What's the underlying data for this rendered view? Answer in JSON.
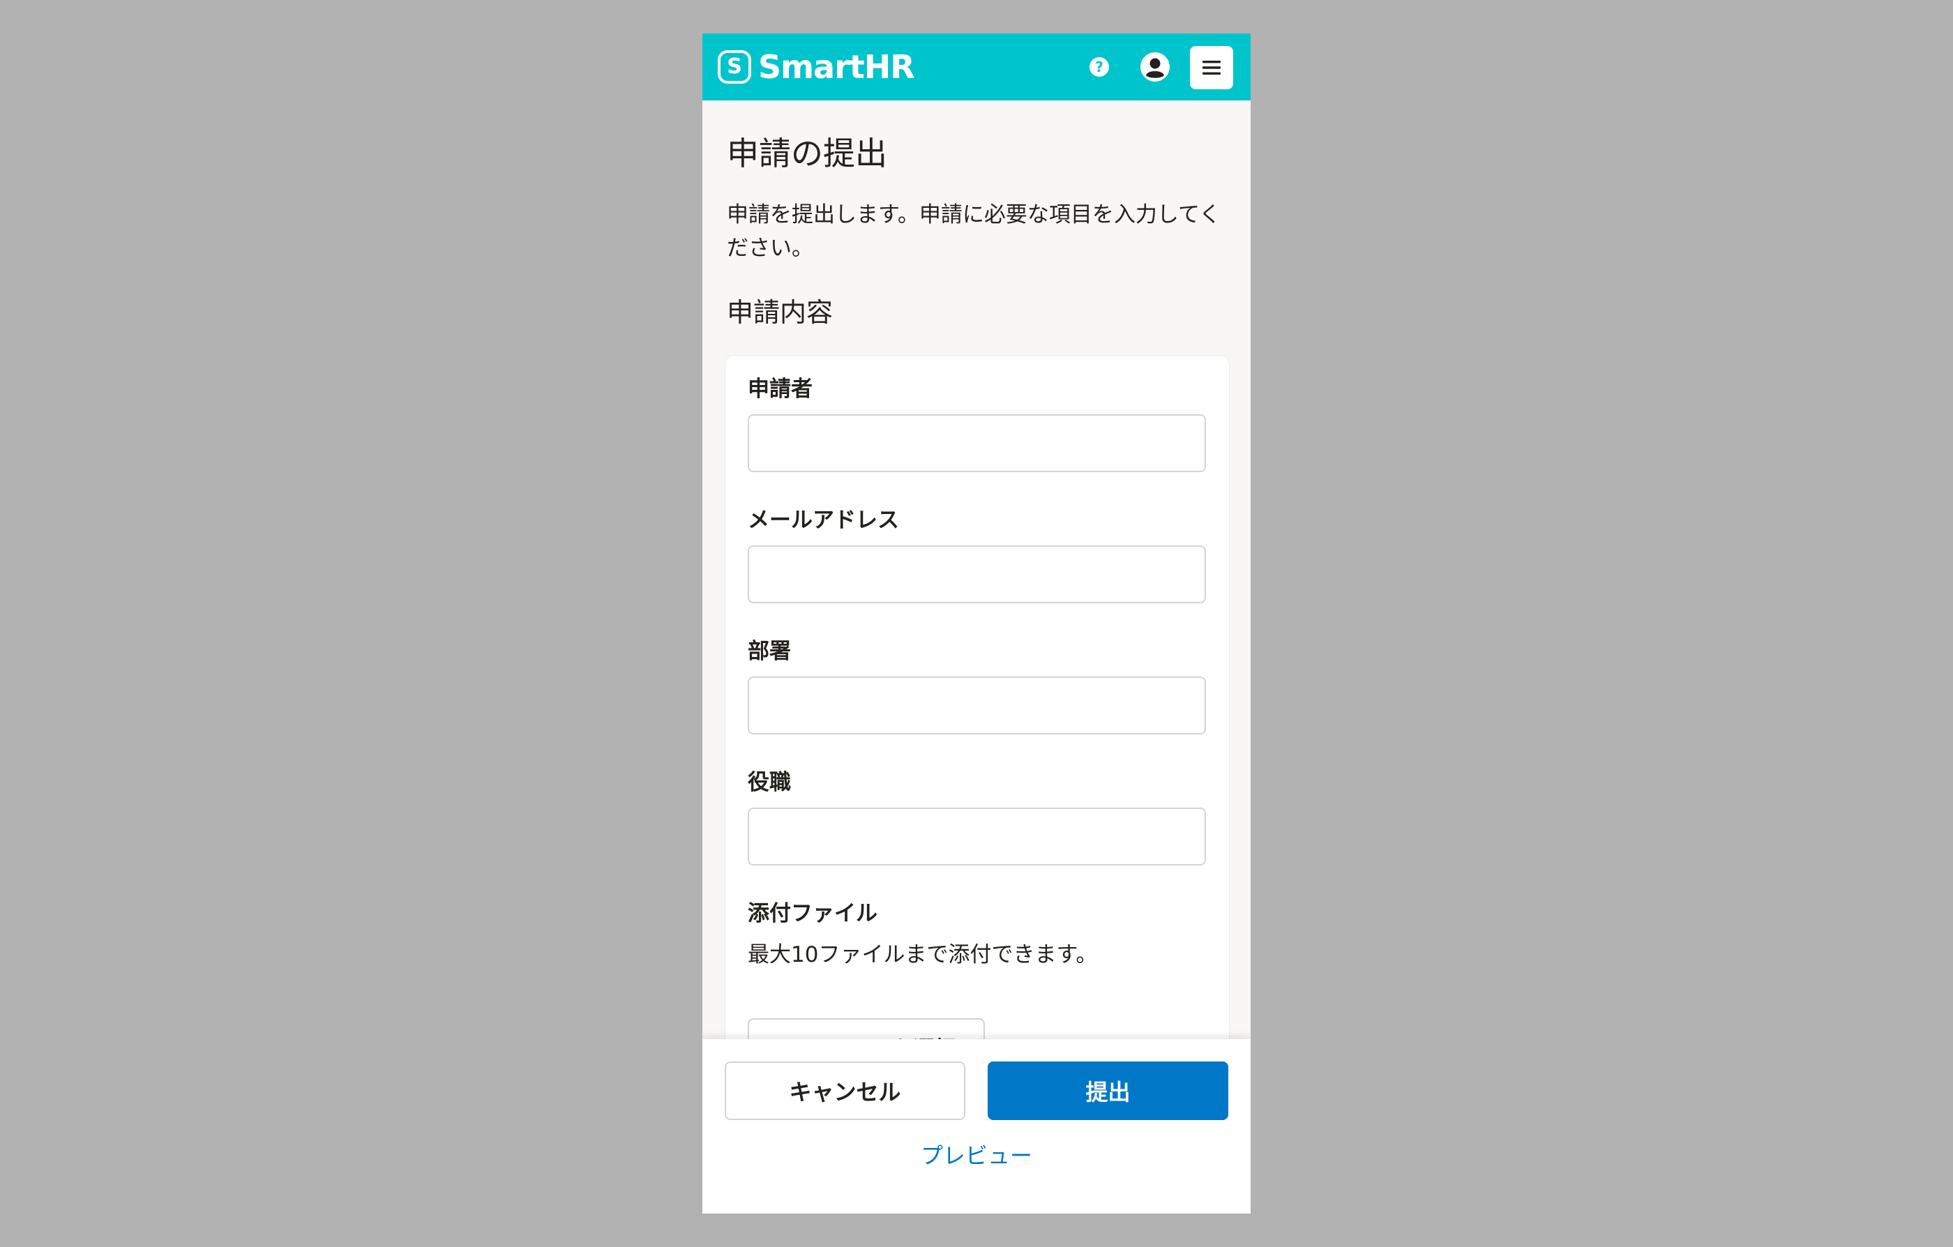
{
  "header": {
    "brand_mark": "S",
    "brand_name": "SmartHR",
    "help_icon": "question-circle-icon",
    "user_icon": "user-circle-icon",
    "menu_icon": "hamburger-menu-icon",
    "help_glyph": "?"
  },
  "page": {
    "title": "申請の提出",
    "description": "申請を提出します。申請に必要な項目を入力してください。",
    "section_title": "申請内容"
  },
  "form": {
    "fields": [
      {
        "label": "申請者",
        "value": "",
        "placeholder": ""
      },
      {
        "label": "メールアドレス",
        "value": "",
        "placeholder": ""
      },
      {
        "label": "部署",
        "value": "",
        "placeholder": ""
      },
      {
        "label": "役職",
        "value": "",
        "placeholder": ""
      }
    ],
    "attachment": {
      "label": "添付ファイル",
      "helper": "最大10ファイルまで添付できます。",
      "button_label": "ファイルを選択",
      "button_icon": "folder-open-icon"
    }
  },
  "actions": {
    "cancel_label": "キャンセル",
    "submit_label": "提出",
    "preview_label": "プレビュー"
  },
  "colors": {
    "brand": "#00c4cc",
    "primary": "#0077c7",
    "background": "#f8f7f6",
    "outer_background": "#b2b2b2",
    "border": "#d6d3d0",
    "text": "#23221e"
  }
}
